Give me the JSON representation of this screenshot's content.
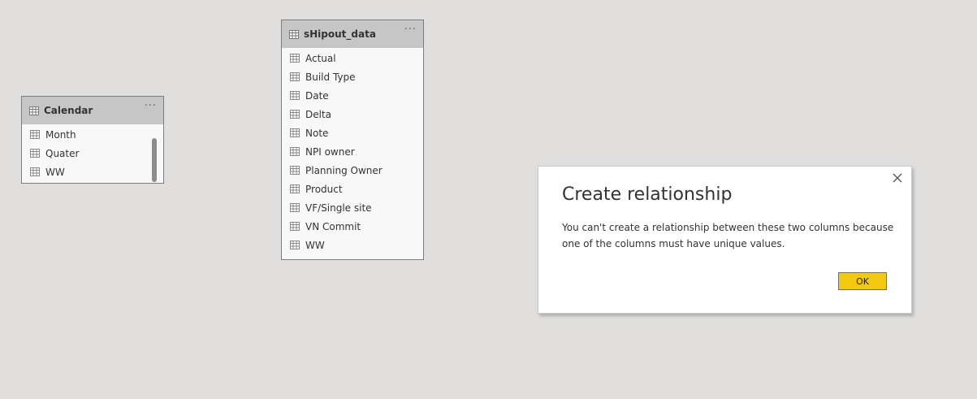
{
  "tables": {
    "calendar": {
      "title": "Calendar",
      "more_label": "···",
      "fields": [
        "Month",
        "Quater",
        "WW"
      ]
    },
    "shipout": {
      "title": "sHipout_data",
      "more_label": "···",
      "fields": [
        "Actual",
        "Build Type",
        "Date",
        "Delta",
        "Note",
        "NPI owner",
        "Planning Owner",
        "Product",
        "VF/Single site",
        "VN Commit",
        "WW"
      ]
    }
  },
  "dialog": {
    "title": "Create relationship",
    "message": "You can't create a relationship between these two columns because one of the columns must have unique values.",
    "ok_label": "OK"
  },
  "colors": {
    "canvas": "#e0dfde",
    "header": "#c6c6c6",
    "accent_button": "#f2c811"
  }
}
